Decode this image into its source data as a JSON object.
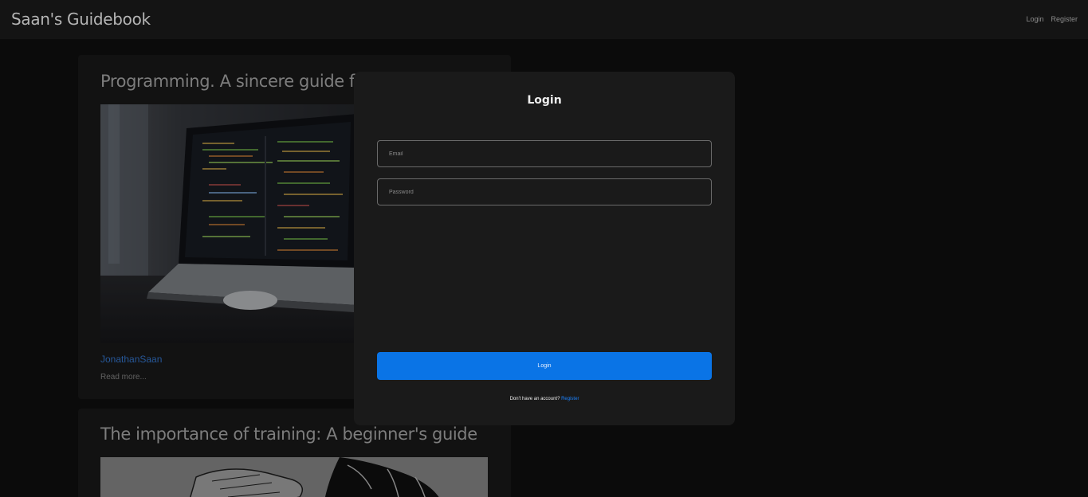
{
  "header": {
    "brand": "Saan's Guidebook",
    "nav": {
      "login": "Login",
      "register": "Register"
    }
  },
  "posts": [
    {
      "title": "Programming. A sincere guide for b",
      "author": "JonathanSaan",
      "read_more": "Read more..."
    },
    {
      "title": "The importance of training: A beginner's guide"
    }
  ],
  "modal": {
    "title": "Login",
    "email_placeholder": "Email",
    "password_placeholder": "Password",
    "submit_label": "Login",
    "footer_text": "Don't have an account?",
    "footer_link": "Register"
  },
  "colors": {
    "accent": "#0a74e6",
    "link": "#1b83ff",
    "background": "#0b0b0b",
    "modal": "#1a1a1a"
  }
}
